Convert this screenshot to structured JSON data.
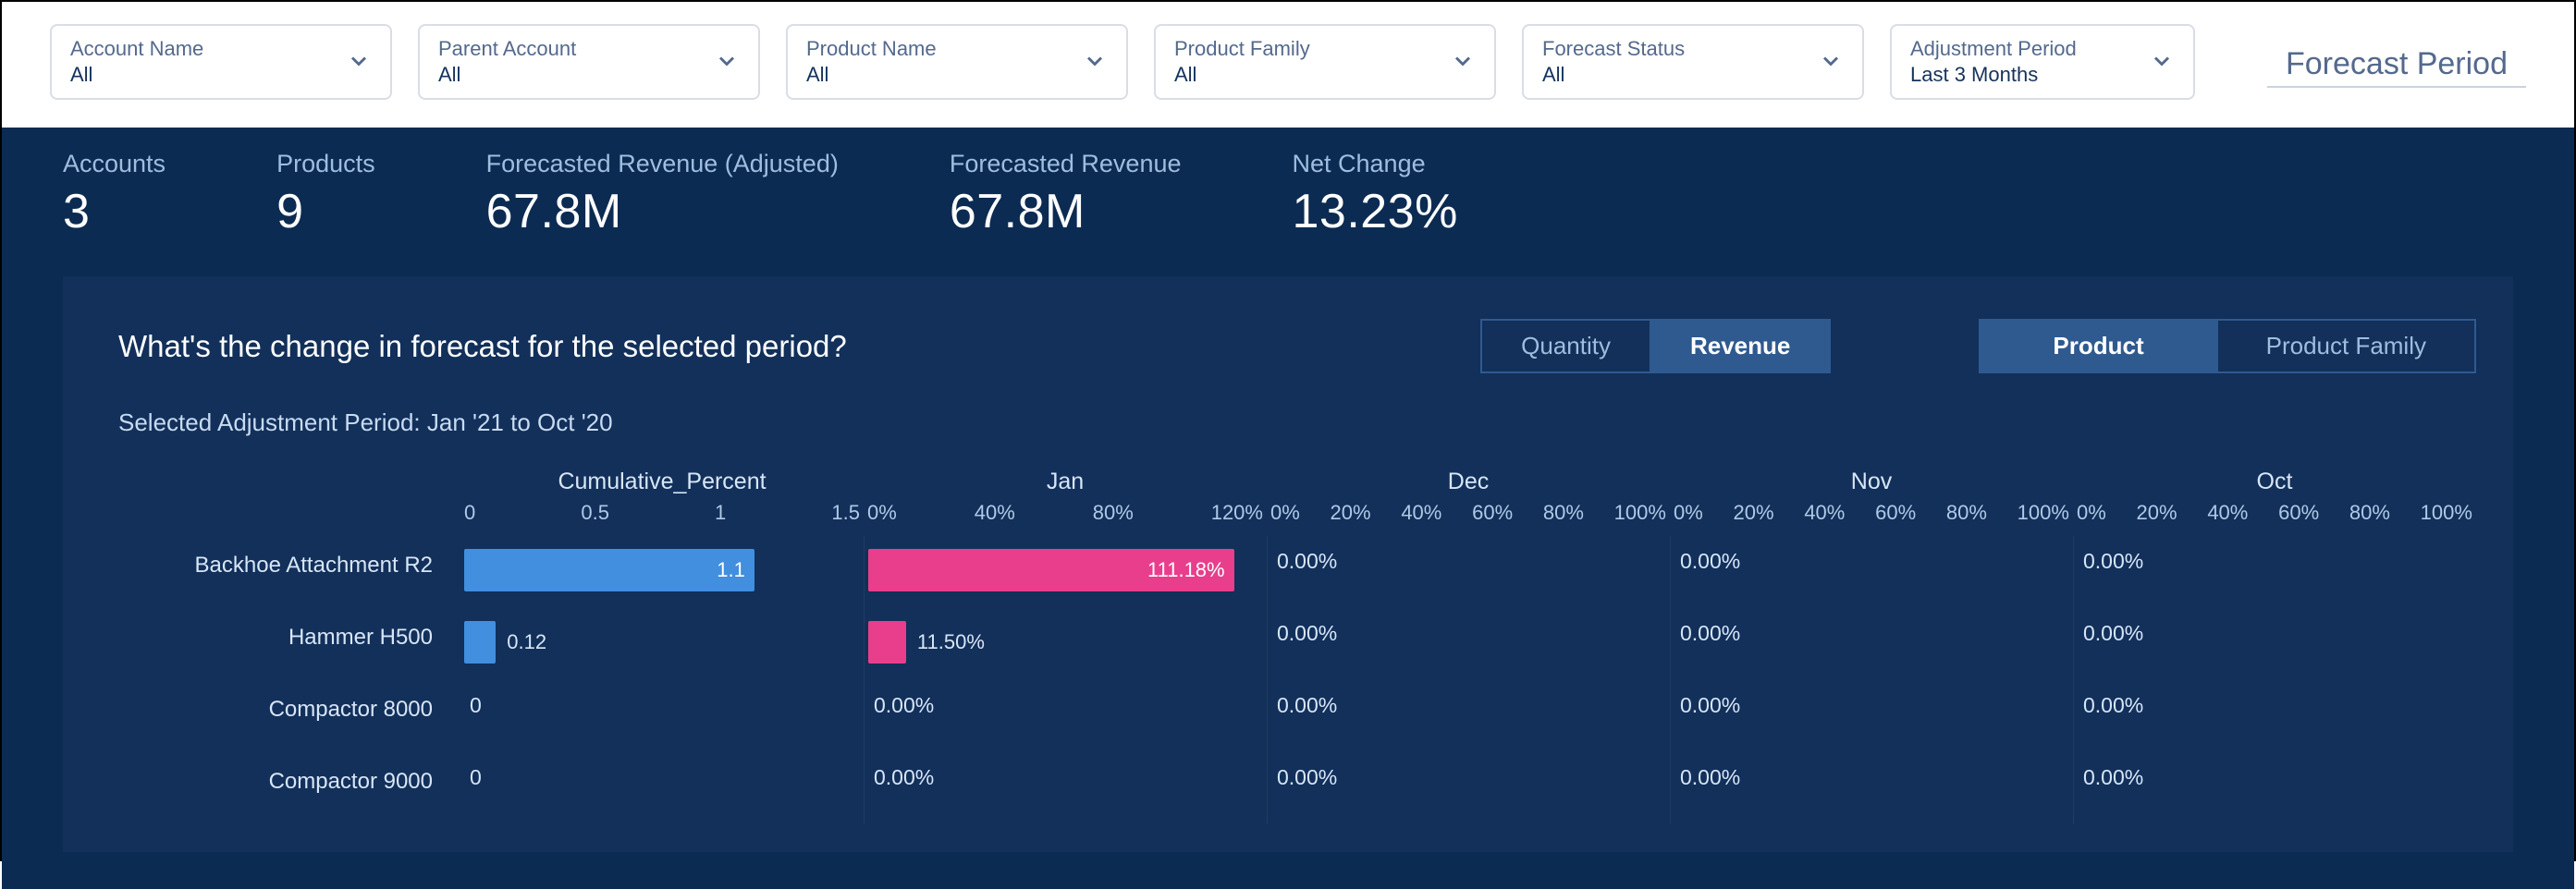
{
  "filters": [
    {
      "label": "Account Name",
      "value": "All"
    },
    {
      "label": "Parent Account",
      "value": "All"
    },
    {
      "label": "Product Name",
      "value": "All"
    },
    {
      "label": "Product Family",
      "value": "All"
    },
    {
      "label": "Forecast Status",
      "value": "All"
    },
    {
      "label": "Adjustment Period",
      "value": "Last 3 Months"
    }
  ],
  "forecast_period_label": "Forecast Period",
  "kpis": [
    {
      "label": "Accounts",
      "value": "3"
    },
    {
      "label": "Products",
      "value": "9"
    },
    {
      "label": "Forecasted Revenue (Adjusted)",
      "value": "67.8M"
    },
    {
      "label": "Forecasted Revenue",
      "value": "67.8M"
    },
    {
      "label": "Net Change",
      "value": "13.23%"
    }
  ],
  "chart_title": "What's the change in forecast for the selected period?",
  "seg_metric": {
    "options": [
      "Quantity",
      "Revenue"
    ],
    "active": "Revenue"
  },
  "seg_dim": {
    "options": [
      "Product",
      "Product Family"
    ],
    "active": "Product"
  },
  "chart_subtitle": "Selected Adjustment Period: Jan '21 to Oct '20",
  "chart_data": {
    "type": "bar",
    "orientation": "horizontal",
    "columns": [
      {
        "name": "Cumulative_Percent",
        "ticks": [
          "0",
          "0.5",
          "1",
          "1.5"
        ],
        "range": [
          0,
          1.5
        ],
        "unit": ""
      },
      {
        "name": "Jan",
        "ticks": [
          "0%",
          "40%",
          "80%",
          "120%"
        ],
        "range": [
          0,
          120
        ],
        "unit": "%"
      },
      {
        "name": "Dec",
        "ticks": [
          "0%",
          "20%",
          "40%",
          "60%",
          "80%",
          "100%"
        ],
        "range": [
          0,
          100
        ],
        "unit": "%"
      },
      {
        "name": "Nov",
        "ticks": [
          "0%",
          "20%",
          "40%",
          "60%",
          "80%",
          "100%"
        ],
        "range": [
          0,
          100
        ],
        "unit": "%"
      },
      {
        "name": "Oct",
        "ticks": [
          "0%",
          "20%",
          "40%",
          "60%",
          "80%",
          "100%"
        ],
        "range": [
          0,
          100
        ],
        "unit": "%"
      }
    ],
    "rows": [
      {
        "label": "Backhoe Attachment R2",
        "values": {
          "Cumulative_Percent": 1.1,
          "Jan": 111.18,
          "Dec": 0.0,
          "Nov": 0.0,
          "Oct": 0.0
        },
        "display": {
          "Cumulative_Percent": "1.1",
          "Jan": "111.18%",
          "Dec": "0.00%",
          "Nov": "0.00%",
          "Oct": "0.00%"
        }
      },
      {
        "label": "Hammer H500",
        "values": {
          "Cumulative_Percent": 0.12,
          "Jan": 11.5,
          "Dec": 0.0,
          "Nov": 0.0,
          "Oct": 0.0
        },
        "display": {
          "Cumulative_Percent": "0.12",
          "Jan": "11.50%",
          "Dec": "0.00%",
          "Nov": "0.00%",
          "Oct": "0.00%"
        }
      },
      {
        "label": "Compactor 8000",
        "values": {
          "Cumulative_Percent": 0,
          "Jan": 0.0,
          "Dec": 0.0,
          "Nov": 0.0,
          "Oct": 0.0
        },
        "display": {
          "Cumulative_Percent": "0",
          "Jan": "0.00%",
          "Dec": "0.00%",
          "Nov": "0.00%",
          "Oct": "0.00%"
        }
      },
      {
        "label": "Compactor 9000",
        "values": {
          "Cumulative_Percent": 0,
          "Jan": 0.0,
          "Dec": 0.0,
          "Nov": 0.0,
          "Oct": 0.0
        },
        "display": {
          "Cumulative_Percent": "0",
          "Jan": "0.00%",
          "Dec": "0.00%",
          "Nov": "0.00%",
          "Oct": "0.00%"
        }
      }
    ],
    "colors": {
      "Cumulative_Percent": "#418fde",
      "Jan": "#e83e8c"
    }
  }
}
